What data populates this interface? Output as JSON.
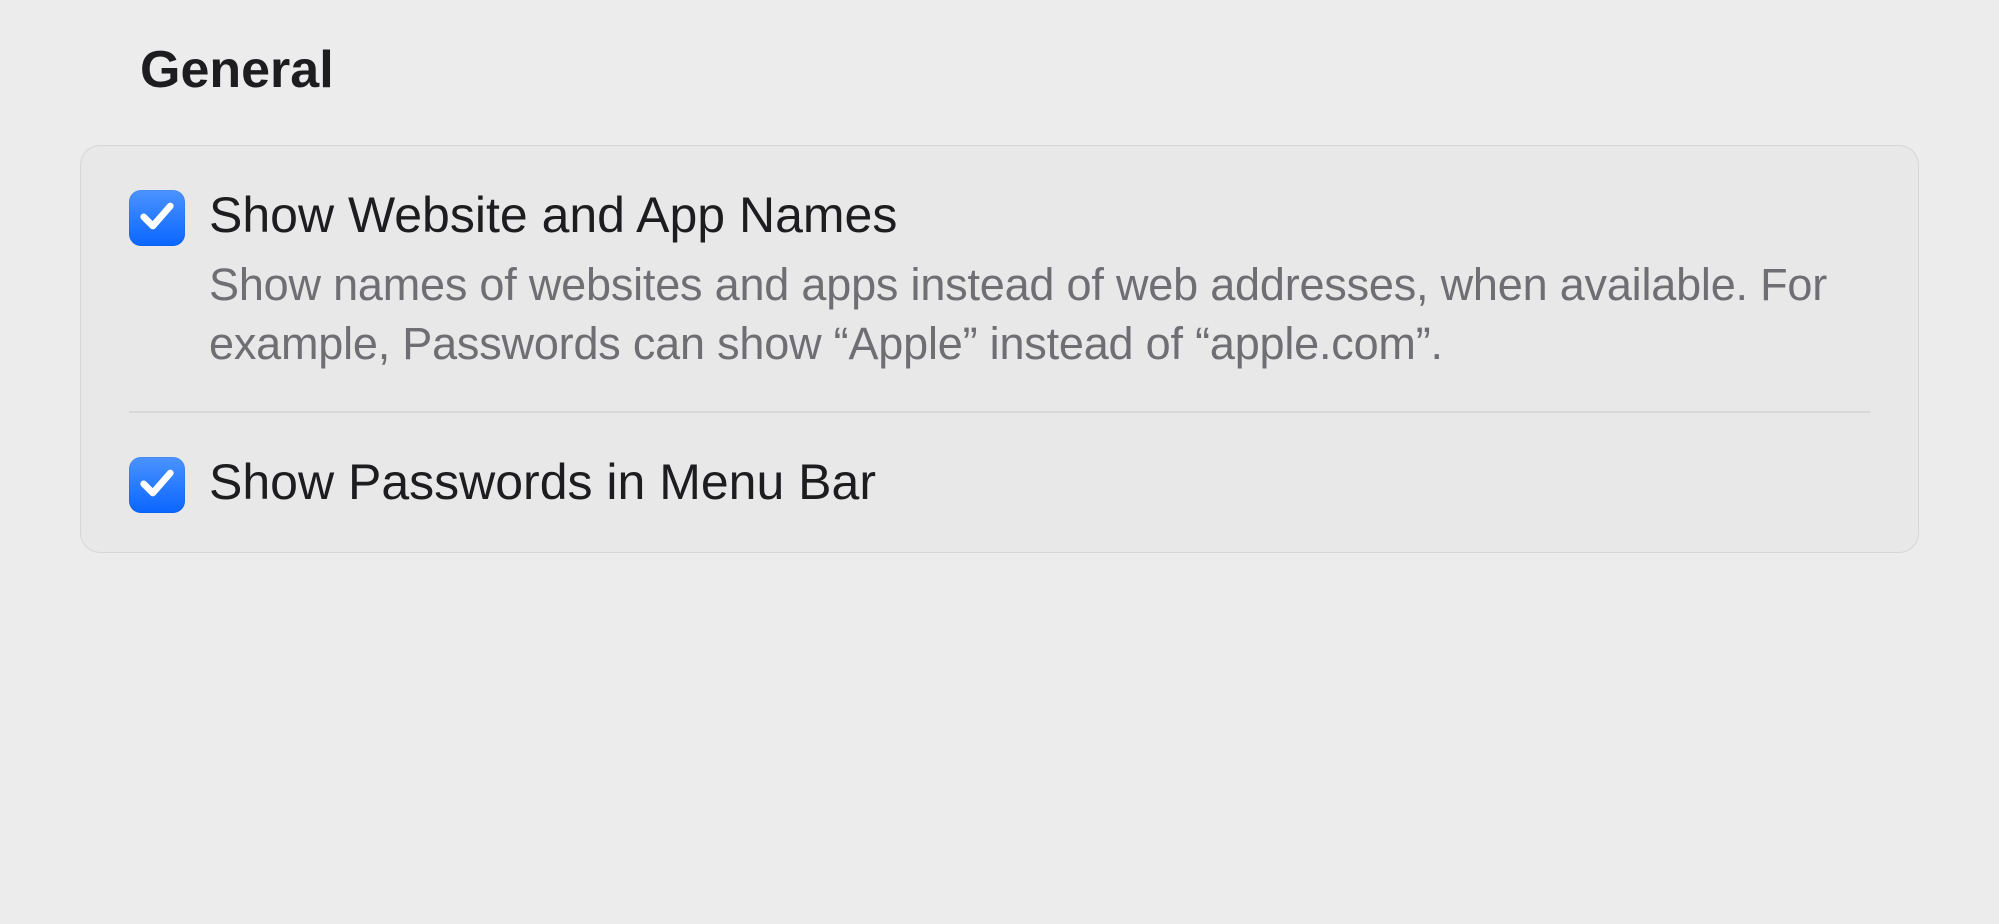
{
  "section": {
    "title": "General"
  },
  "settings": {
    "showWebsiteAppNames": {
      "label": "Show Website and App Names",
      "description": "Show names of websites and apps instead of web addresses, when available. For example, Passwords can show “Apple” instead of “apple.com”.",
      "checked": true
    },
    "showPasswordsMenuBar": {
      "label": "Show Passwords in Menu Bar",
      "checked": true
    }
  }
}
